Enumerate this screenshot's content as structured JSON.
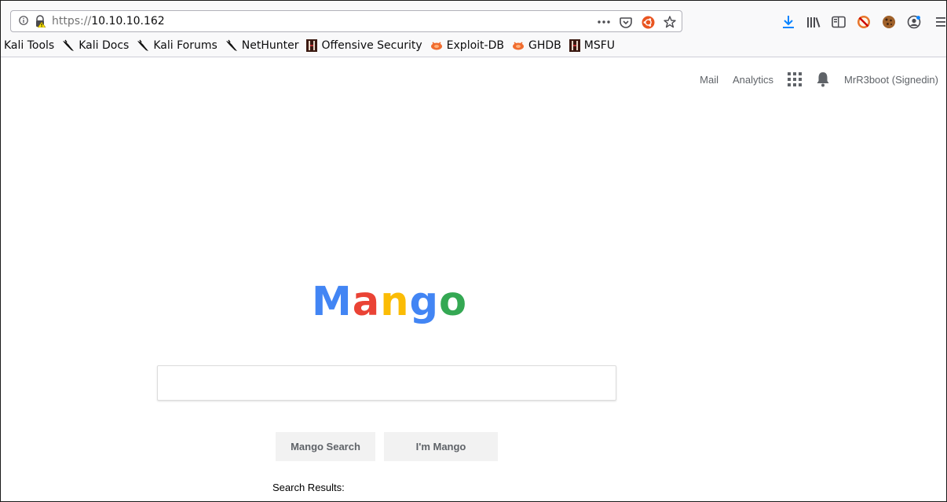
{
  "browser": {
    "url_scheme": "https://",
    "url_host": "10.10.10.162",
    "bookmarks": [
      {
        "label": "Kali Tools",
        "icon": "none"
      },
      {
        "label": "Kali Docs",
        "icon": "kali-dragon-icon"
      },
      {
        "label": "Kali Forums",
        "icon": "kali-dragon-icon"
      },
      {
        "label": "NetHunter",
        "icon": "kali-dragon-icon"
      },
      {
        "label": "Offensive Security",
        "icon": "offsec-icon"
      },
      {
        "label": "Exploit-DB",
        "icon": "exploitdb-icon"
      },
      {
        "label": "GHDB",
        "icon": "exploitdb-icon"
      },
      {
        "label": "MSFU",
        "icon": "offsec-icon"
      }
    ]
  },
  "nav": {
    "mail": "Mail",
    "analytics": "Analytics",
    "user": "MrR3boot (Signedin)"
  },
  "logo": {
    "letters": [
      {
        "ch": "M",
        "color": "#4285f4"
      },
      {
        "ch": "a",
        "color": "#ea4335"
      },
      {
        "ch": "n",
        "color": "#fbbc05"
      },
      {
        "ch": "g",
        "color": "#4285f4"
      },
      {
        "ch": "o",
        "color": "#34a853"
      }
    ]
  },
  "search": {
    "value": "",
    "button_primary": "Mango Search",
    "button_secondary": "I'm Mango",
    "results_label": "Search Results:"
  }
}
